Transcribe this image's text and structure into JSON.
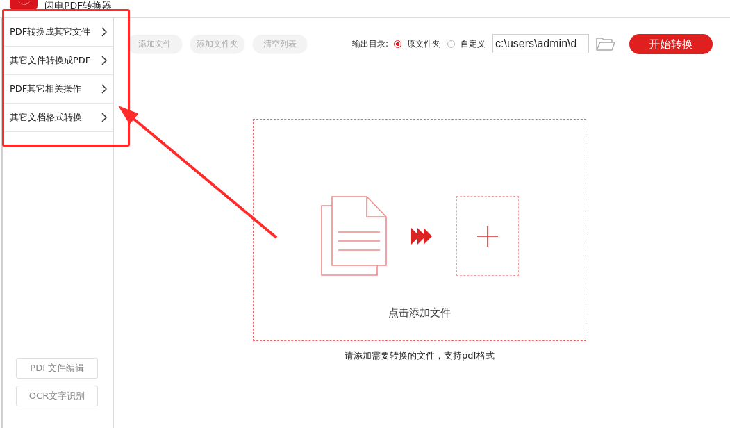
{
  "window": {
    "title": "闪电PDF转换器"
  },
  "sidebar": {
    "items": [
      {
        "label": "PDF转换成其它文件"
      },
      {
        "label": "其它文件转换成PDF"
      },
      {
        "label": "PDF其它相关操作"
      },
      {
        "label": "其它文档格式转换"
      }
    ],
    "tools": [
      {
        "label": "PDF文件编辑"
      },
      {
        "label": "OCR文字识别"
      }
    ]
  },
  "toolbar": {
    "buttons": [
      {
        "label": "添加文件",
        "disabled": true
      },
      {
        "label": "添加文件夹",
        "disabled": true
      },
      {
        "label": "清空列表",
        "disabled": true
      }
    ],
    "output": {
      "label": "输出目录:",
      "options": [
        {
          "label": "原文件夹",
          "selected": true
        },
        {
          "label": "自定义",
          "selected": false
        }
      ],
      "path": "c:\\users\\admin\\d"
    },
    "start_button": "开始转换"
  },
  "drop_area": {
    "label": "点击添加文件"
  },
  "hint": "请添加需要转换的文件，支持pdf格式"
}
